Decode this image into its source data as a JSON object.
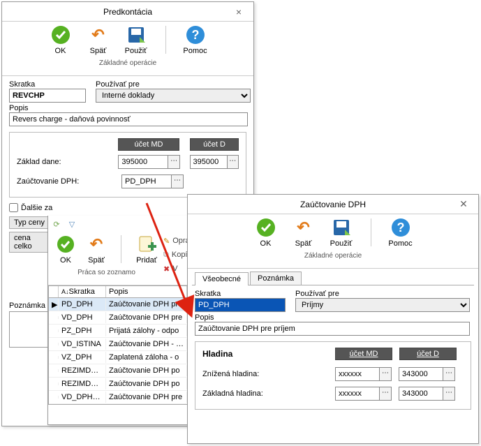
{
  "win1": {
    "title": "Predkontácia",
    "toolbar": {
      "ok": "OK",
      "back": "Späť",
      "use": "Použiť",
      "help": "Pomoc",
      "caption": "Základné operácie"
    },
    "fields": {
      "skratka_label": "Skratka",
      "skratka": "REVCHP",
      "pouzivat_label": "Používať pre",
      "pouzivat": "Interné doklady",
      "popis_label": "Popis",
      "popis": "Revers charge - daňová povinnosť"
    },
    "accounts": {
      "hdr_md": "účet MD",
      "hdr_d": "účet D",
      "zaklad_label": "Základ dane:",
      "zaklad_md": "395000",
      "zaklad_d": "395000",
      "dph_label": "Zaúčtovanie DPH:",
      "dph_val": "PD_DPH"
    },
    "chk_dalsie": "Ďalšie za",
    "typ_label": "Typ ceny",
    "typ_btn": "cena celko",
    "poznamka_label": "Poznámka"
  },
  "list": {
    "toolbar": {
      "ok": "OK",
      "back": "Späť",
      "add": "Pridať",
      "edit": "Opra",
      "copy": "Kopí",
      "del": "V",
      "caption": "Práca so zoznamo"
    },
    "hdr_skratka": "Skratka",
    "hdr_popis": "Popis",
    "rows": [
      {
        "m": "▶",
        "s": "PD_DPH",
        "p": "Zaúčtovanie DPH pre"
      },
      {
        "m": "",
        "s": "VD_DPH",
        "p": "Zaúčtovanie DPH pre"
      },
      {
        "m": "",
        "s": "PZ_DPH",
        "p": "Prijatá zálohy - odpo"
      },
      {
        "m": "",
        "s": "VD_ISTINA",
        "p": "Zaúčtovanie DPH - sp"
      },
      {
        "m": "",
        "s": "VZ_DPH",
        "p": "Zaplatená záloha - o"
      },
      {
        "m": "",
        "s": "REZIMDPH-P",
        "p": "Zaúčtovanie DPH po"
      },
      {
        "m": "",
        "s": "REZIMDPH-O",
        "p": "Zaúčtovanie DPH po"
      },
      {
        "m": "",
        "s": "VD_DPH_ZAP",
        "p": "Zaúčtovanie DPH pre"
      }
    ]
  },
  "win2": {
    "title": "Zaúčtovanie DPH",
    "toolbar": {
      "ok": "OK",
      "back": "Späť",
      "use": "Použiť",
      "help": "Pomoc",
      "caption": "Základné operácie"
    },
    "tabs": {
      "general": "Všeobecné",
      "note": "Poznámka"
    },
    "fields": {
      "skratka_label": "Skratka",
      "skratka": "PD_DPH",
      "pouzivat_label": "Používať pre",
      "pouzivat": "Príjmy",
      "popis_label": "Popis",
      "popis": "Zaúčtovanie DPH pre príjem"
    },
    "hladina": {
      "title": "Hladina",
      "hdr_md": "účet MD",
      "hdr_d": "účet D",
      "znizena_label": "Znížená hladina:",
      "znizena_md": "xxxxxx",
      "znizena_d": "343000",
      "zakladna_label": "Základná hladina:",
      "zakladna_md": "xxxxxx",
      "zakladna_d": "343000"
    }
  }
}
